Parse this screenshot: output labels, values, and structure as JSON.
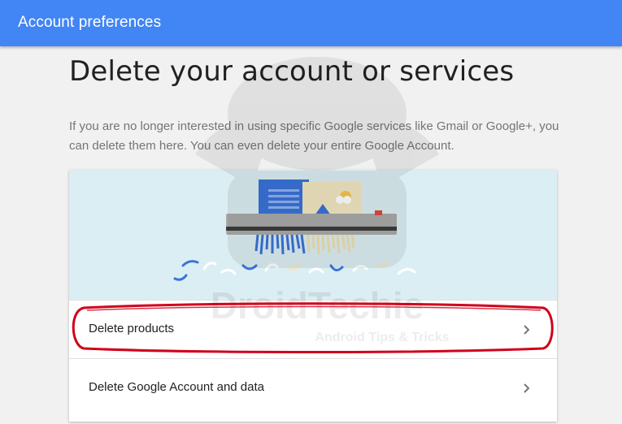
{
  "header": {
    "title": "Account preferences",
    "background_color": "#4285f4"
  },
  "main": {
    "title": "Delete your account or services",
    "description": "If you are no longer interested in using specific Google services like Gmail or Google+, you can delete them here. You can even delete your entire Google Account."
  },
  "card": {
    "illustration_icon": "shredder-illustration",
    "items": [
      {
        "label": "Delete products",
        "icon": "chevron-right-icon"
      },
      {
        "label": "Delete Google Account and data",
        "icon": "chevron-right-icon"
      }
    ]
  },
  "overlay": {
    "watermark_title": "DroidTechie",
    "watermark_subtitle": "Android Tips & Tricks",
    "annotation_color": "#d0021b"
  }
}
